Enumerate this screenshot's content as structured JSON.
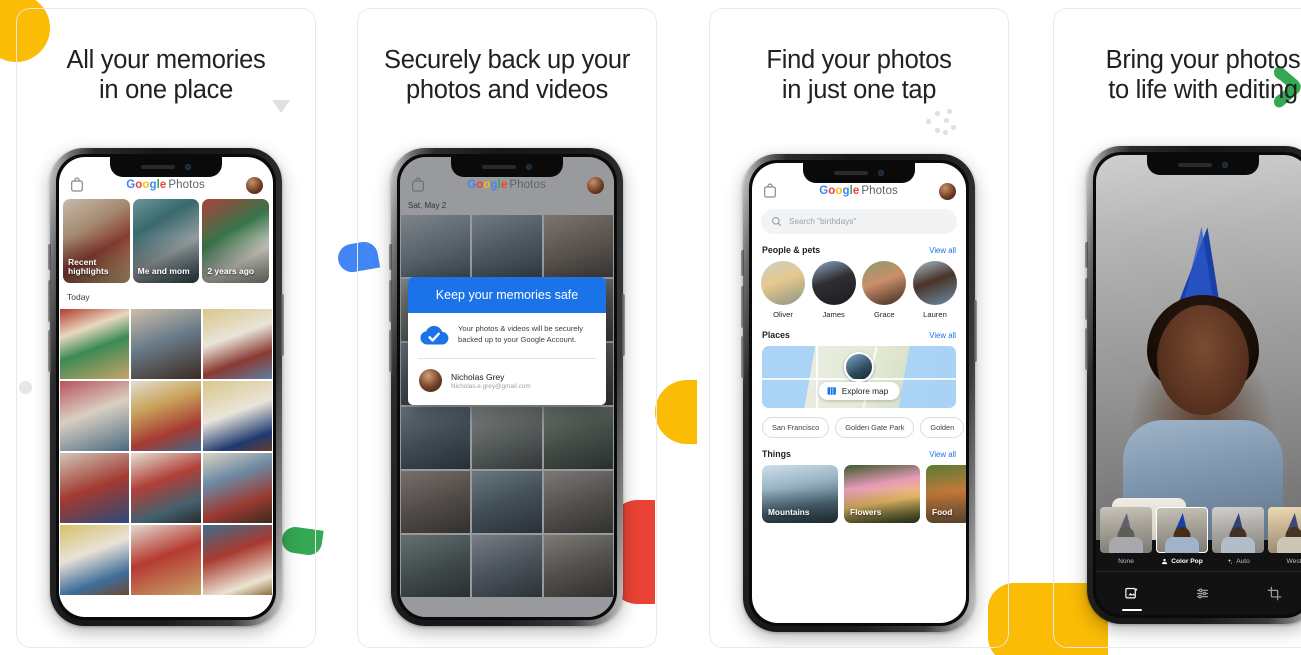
{
  "panels": [
    {
      "id": "memories",
      "headline_line1": "All your memories",
      "headline_line2": "in one place",
      "app": {
        "brand_g": "G",
        "brand_o1": "o",
        "brand_o2": "o",
        "brand_g2": "g",
        "brand_l": "l",
        "brand_e": "e",
        "brand_suffix": "Photos",
        "lockup_icon": "photos-lockup-icon",
        "avatar": "account-avatar"
      },
      "memories": [
        {
          "label": "Recent highlights"
        },
        {
          "label": "Me and mom"
        },
        {
          "label": "2 years ago"
        }
      ],
      "section_label": "Today"
    },
    {
      "id": "backup",
      "headline_line1": "Securely back up your",
      "headline_line2": "photos and videos",
      "app": {
        "brand_suffix": "Photos"
      },
      "date_label": "Sat, May 2",
      "dialog": {
        "title": "Keep your memories safe",
        "body_line1": "Your photos & videos will be securely",
        "body_line2": "backed up to your Google Account.",
        "account_name": "Nicholas Grey",
        "account_email": "Nicholas.e.grey@gmail.com",
        "cloud_icon": "cloud-check-icon",
        "header_color": "#1A73E8"
      }
    },
    {
      "id": "search",
      "headline_line1": "Find your photos",
      "headline_line2": "in just one tap",
      "app": {
        "brand_suffix": "Photos"
      },
      "search": {
        "placeholder": "Search \"birthdays\"",
        "icon": "search-icon"
      },
      "sections": [
        {
          "title": "People & pets",
          "action": "View all"
        },
        {
          "title": "Places",
          "action": "View all"
        },
        {
          "title": "Things",
          "action": "View all"
        }
      ],
      "people": [
        {
          "name": "Oliver"
        },
        {
          "name": "James"
        },
        {
          "name": "Grace"
        },
        {
          "name": "Lauren"
        }
      ],
      "map": {
        "explore_label": "Explore map",
        "explore_icon": "map-icon"
      },
      "place_chips": [
        "San Francisco",
        "Golden Gate Park",
        "Golden"
      ],
      "things": [
        {
          "label": "Mountains"
        },
        {
          "label": "Flowers"
        },
        {
          "label": "Food"
        }
      ]
    },
    {
      "id": "editing",
      "headline_line1": "Bring your photos",
      "headline_line2": "to life with editing",
      "filters": [
        {
          "name": "None",
          "icon": "",
          "selected": false
        },
        {
          "name": "Color Pop",
          "icon": "person-icon",
          "selected": true
        },
        {
          "name": "Auto",
          "icon": "sparkle-icon",
          "selected": false
        },
        {
          "name": "West",
          "icon": "",
          "selected": false
        }
      ],
      "edit_tabs": [
        {
          "icon": "photo-filter-icon",
          "active": true
        },
        {
          "icon": "adjust-sliders-icon",
          "active": false
        },
        {
          "icon": "crop-rotate-icon",
          "active": false
        }
      ]
    }
  ],
  "decor": {
    "yellow": "#FBBC05",
    "blue": "#4285F4",
    "green": "#34A853",
    "red": "#EA4335",
    "gray": "#E0E0E0"
  },
  "brand_colors": {
    "blue": "#4285F4",
    "red": "#EA4335",
    "yellow": "#FBBC05",
    "green": "#34A853",
    "text": "#5f6368"
  }
}
